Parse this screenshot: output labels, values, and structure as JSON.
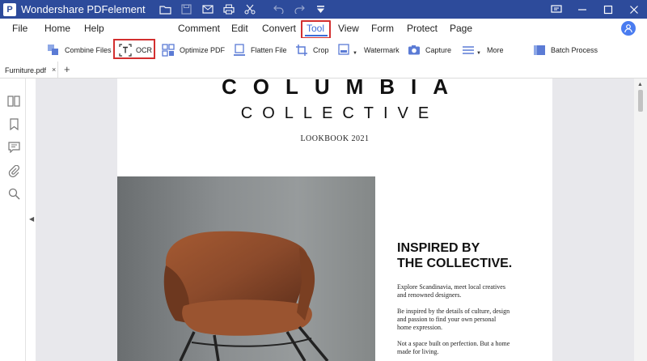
{
  "app": {
    "title": "Wondershare PDFelement",
    "logo_letter": "P"
  },
  "quick_access": {
    "icons": [
      "folder-icon",
      "save-icon",
      "email-icon",
      "print-icon",
      "scissors-icon",
      "undo-icon",
      "redo-icon",
      "dropdown-icon"
    ]
  },
  "window_controls": {
    "feedback": "▭",
    "minimize": "—",
    "maximize": "☐",
    "close": "✕"
  },
  "menu": {
    "file": "File",
    "home": "Home",
    "help": "Help",
    "comment": "Comment",
    "edit": "Edit",
    "convert": "Convert",
    "tool": "Tool",
    "view": "View",
    "form": "Form",
    "protect": "Protect",
    "page": "Page"
  },
  "toolbar": {
    "combine_files": "Combine Files",
    "ocr": "OCR",
    "optimize_pdf": "Optimize PDF",
    "flatten_file": "Flatten File",
    "crop": "Crop",
    "watermark": "Watermark",
    "capture": "Capture",
    "more": "More",
    "batch_process": "Batch Process"
  },
  "tabs": {
    "document_name": "Furniture.pdf",
    "close": "×",
    "add": "+"
  },
  "document": {
    "brand_line1": "COLUMBIA",
    "brand_line2": "COLLECTIVE",
    "subtitle": "LOOKBOOK 2021",
    "heading_line1": "INSPIRED BY",
    "heading_line2": "THE COLLECTIVE.",
    "paragraph1": "Explore Scandinavia, meet local creatives and renowned designers.",
    "paragraph2": "Be inspired by the details of culture, design and passion to find your own personal home expression.",
    "paragraph3": "Not a space built on perfection. But a home made for living."
  },
  "colors": {
    "titlebar": "#2d4b9b",
    "highlight_box": "#d32f2f",
    "accent": "#3b6cd8",
    "chair": "#8b4a2b"
  }
}
